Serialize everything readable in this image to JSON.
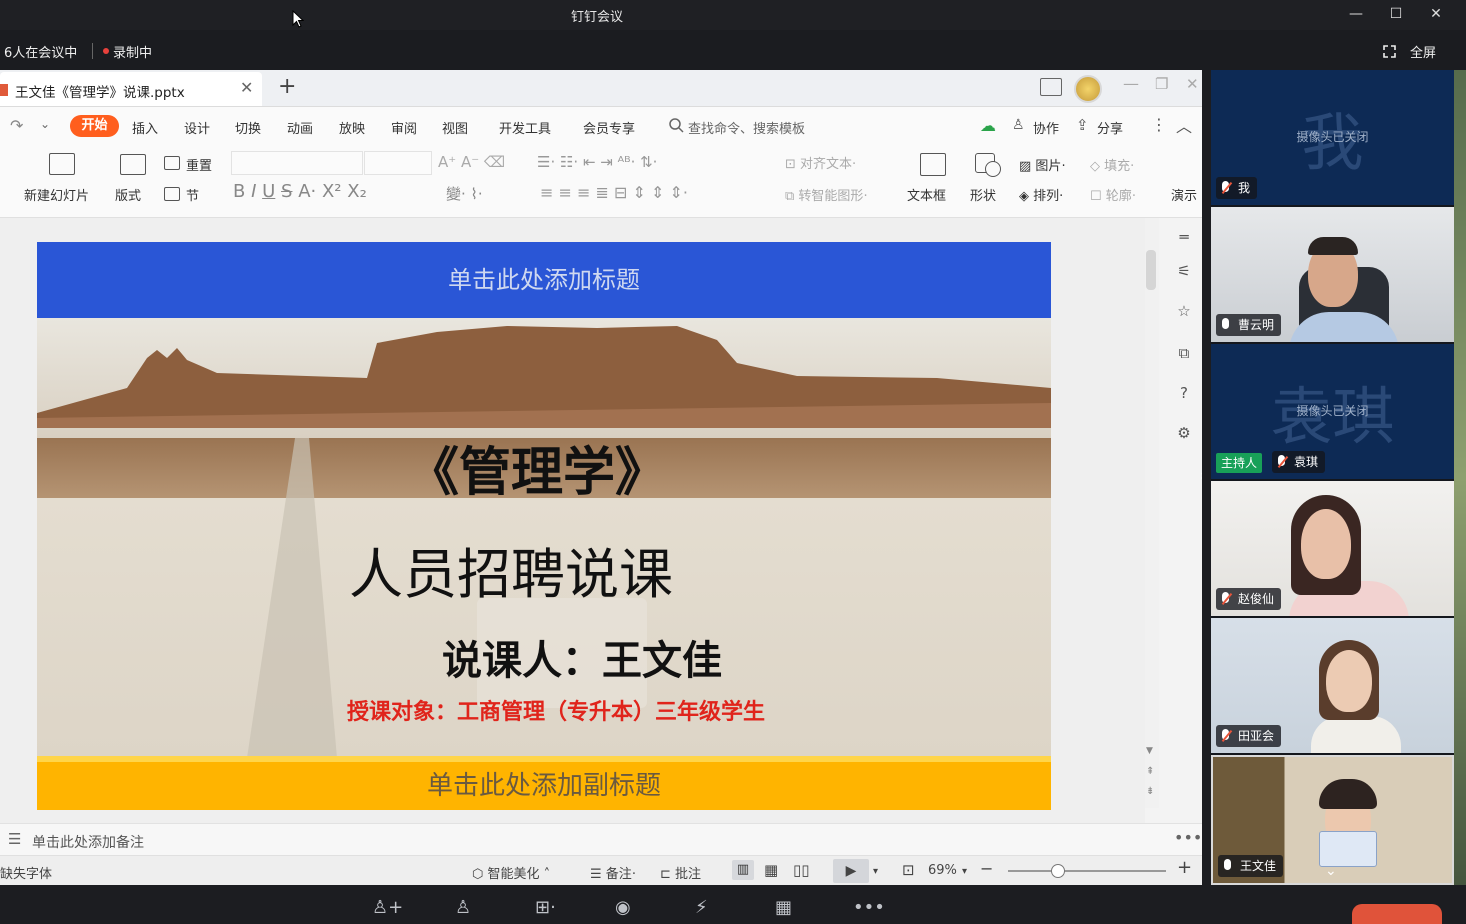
{
  "window": {
    "title": "钉钉会议"
  },
  "status": {
    "participants": "6人在会议中",
    "recording": "录制中",
    "fullscreen": "全屏"
  },
  "doc": {
    "tab_name": "王文佳《管理学》说课.pptx"
  },
  "menu": {
    "start": "开始",
    "items": [
      "插入",
      "设计",
      "切换",
      "动画",
      "放映",
      "审阅",
      "视图",
      "开发工具",
      "会员专享"
    ],
    "search_placeholder": "查找命令、搜索模板",
    "collab": "协作",
    "share": "分享"
  },
  "ribbon": {
    "new_slide": "新建幻灯片",
    "layout": "版式",
    "reset": "重置",
    "section": "节",
    "align_text": "对齐文本",
    "smart_graphic": "转智能图形",
    "textbox": "文本框",
    "shape": "形状",
    "picture": "图片",
    "arrange": "排列",
    "fill": "填充",
    "outline": "轮廓",
    "present": "演示"
  },
  "slide": {
    "title_placeholder": "单击此处添加标题",
    "course": "《管理学》",
    "topic": "人员招聘说课",
    "speaker": "说课人：王文佳",
    "audience": "授课对象：工商管理（专升本）三年级学生",
    "subtitle_placeholder": "单击此处添加副标题"
  },
  "notes": {
    "placeholder": "单击此处添加备注"
  },
  "statusbar": {
    "missing_font": "缺失字体",
    "beautify": "智能美化",
    "notes": "备注",
    "comments": "批注",
    "zoom": "69%"
  },
  "participants": [
    {
      "name": "我",
      "watermark": "我",
      "camera": "摄像头已关闭",
      "muted": true
    },
    {
      "name": "曹云明",
      "muted": false
    },
    {
      "name": "袁琪",
      "watermark": "袁琪",
      "camera": "摄像头已关闭",
      "muted": true,
      "role": "主持人"
    },
    {
      "name": "赵俊仙",
      "muted": true
    },
    {
      "name": "田亚会",
      "muted": true
    },
    {
      "name": "王文佳",
      "muted": false
    }
  ]
}
